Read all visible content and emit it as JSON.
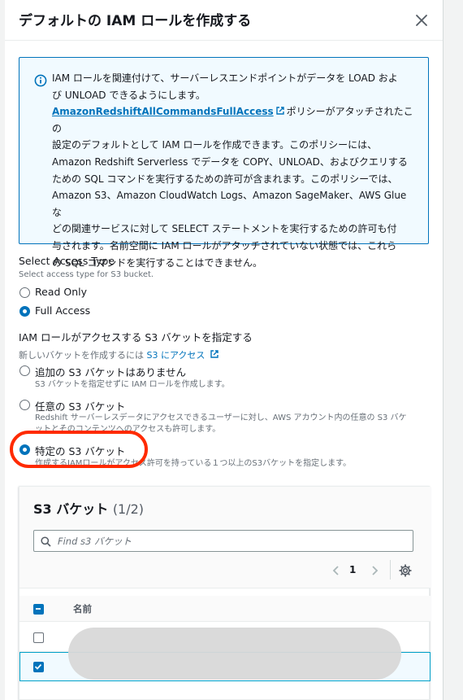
{
  "modal": {
    "title": "デフォルトの IAM ロールを作成する"
  },
  "info": {
    "line1": "IAM ロールを関連付けて、サーバーレスエンドポイントがデータを LOAD およ",
    "line2": "び UNLOAD できるようにします。",
    "link": "AmazonRedshiftAllCommandsFullAccess",
    "line3_after": "ポリシーがアタッチされたこの",
    "line4": "設定のデフォルトとして IAM ロールを作成できます。このポリシーには、",
    "line5": "Amazon Redshift Serverless でデータを COPY、UNLOAD、およびクエリする",
    "line6": "ための SQL コマンドを実行するための許可が含まれます。このポリシーでは、",
    "line7": "Amazon S3、Amazon CloudWatch Logs、Amazon SageMaker、AWS Glue な",
    "line8": "どの関連サービスに対して SELECT ステートメントを実行するための許可も付",
    "line9": "与されます。名前空間に IAM ロールがアタッチされていない状態では、これら",
    "line10": "の SQL コマンドを実行することはできません。"
  },
  "access_type": {
    "label": "Select Access Type",
    "description": "Select access type for S3 bucket.",
    "options": [
      {
        "label": "Read Only",
        "checked": false
      },
      {
        "label": "Full Access",
        "checked": true
      }
    ]
  },
  "s3_scope": {
    "label": "IAM ロールがアクセスする S3 バケットを指定する",
    "hint_prefix": "新しいバケットを作成するには",
    "hint_link": "S3 にアクセス",
    "options": [
      {
        "label": "追加の S3 バケットはありません",
        "description": "S3 バケットを指定せずに IAM ロールを作成します。",
        "checked": false
      },
      {
        "label": "任意の S3 バケット",
        "description": "Redshift サーバーレスデータにアクセスできるユーザーに対し、AWS アカウント内の任意の S3 バケ",
        "description2": "ットとそのコンテンツへのアクセスも許可します。",
        "checked": false
      },
      {
        "label": "特定の S3 バケット",
        "description": "作成するIAMロールがアクセス許可を持っている１つ以上のS3バケットを指定します。",
        "checked": true
      }
    ]
  },
  "bucket_table": {
    "title": "S3 バケット",
    "count": "(1/2)",
    "search_placeholder": "Find s3 バケット",
    "page": "1",
    "column_name": "名前",
    "rows": [
      {
        "checked": false
      },
      {
        "checked": true
      }
    ]
  },
  "colors": {
    "accent": "#0073bb",
    "highlight": "#ff2a00",
    "info_bg": "#f1faff"
  }
}
